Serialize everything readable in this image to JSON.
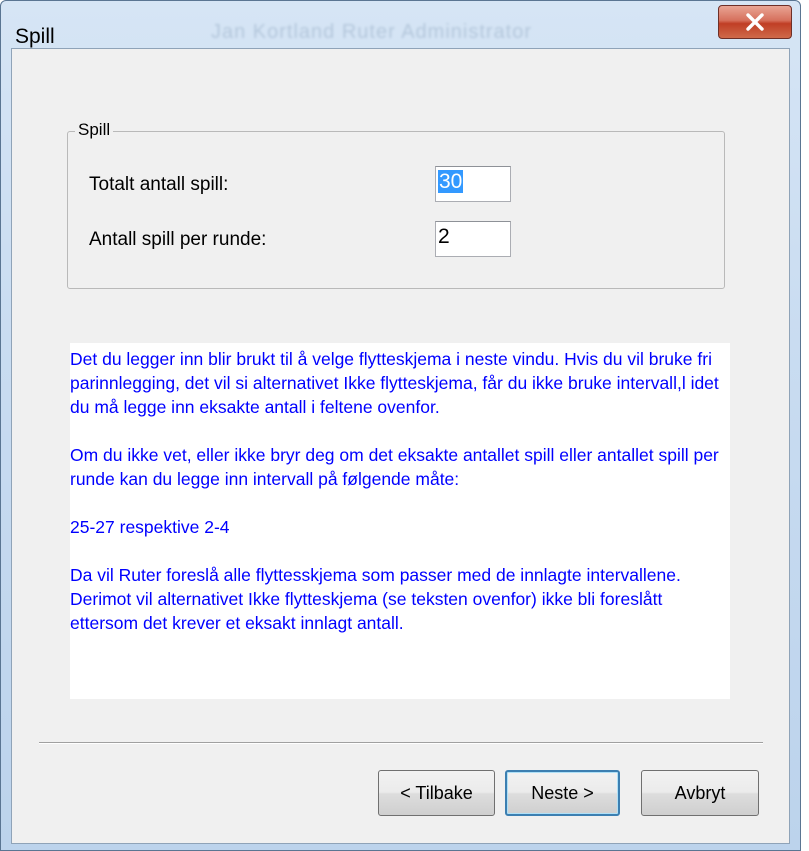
{
  "window": {
    "title": "Spill",
    "close_glyph": "X",
    "background_title": "Jan Kortland  Ruter  Administrator"
  },
  "group": {
    "legend": "Spill",
    "fields": [
      {
        "label": "Totalt antall spill:",
        "value": "30",
        "selected": true
      },
      {
        "label": "Antall spill per runde:",
        "value": "2",
        "selected": false
      }
    ]
  },
  "info": {
    "paragraphs": [
      "Det du legger inn blir brukt til å velge flytteskjema i neste vindu. Hvis du vil bruke fri parinnlegging, det vil si alternativet Ikke flytteskjema, får du ikke bruke intervall,l idet du må legge inn eksakte antall i feltene ovenfor.",
      "Om du ikke vet, eller ikke bryr deg om det eksakte antallet spill eller antallet spill per runde kan du legge inn intervall på følgende måte:",
      "25-27 respektive 2-4",
      "Da vil Ruter foreslå alle flyttesskjema som passer med de innlagte intervallene. Derimot vil alternativet Ikke flytteskjema (se teksten ovenfor) ikke bli foreslått ettersom det krever et eksakt innlagt antall."
    ],
    "text_color": "#0000ff"
  },
  "buttons": {
    "back": "< Tilbake",
    "next": "Neste >",
    "cancel": "Avbryt"
  },
  "colors": {
    "close_button": "#c9462c",
    "client_bg": "#f0f0f0",
    "default_button_border": "#3c7fb1"
  }
}
